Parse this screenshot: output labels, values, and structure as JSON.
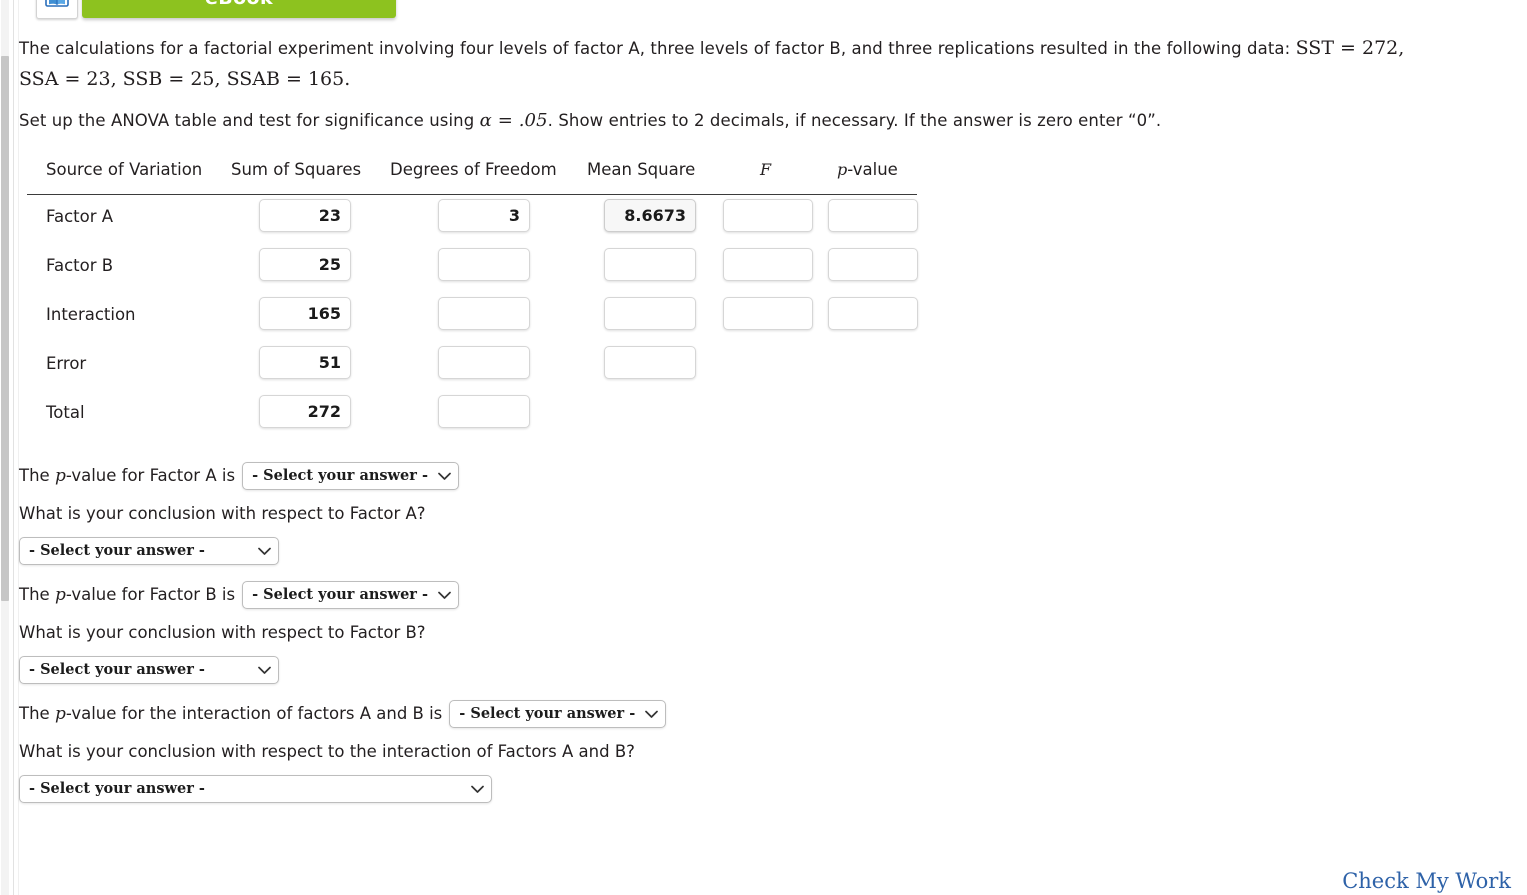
{
  "ebook": {
    "label": "eBook",
    "icon": "ebook-icon",
    "color": "#8dc21f"
  },
  "problem": {
    "statement_part1": "The calculations for a factorial experiment involving four levels of factor A, three levels of factor B, and three replications resulted in the following data: ",
    "statement_math1": "SST = 272,",
    "statement_math2": "SSA = 23, SSB = 25, SSAB = 165.",
    "instruction_part1": "Set up the ANOVA table and test for significance using ",
    "instruction_alpha": "α = .05",
    "instruction_part2": ". Show entries to 2 decimals, if necessary. If the answer is zero enter “0”."
  },
  "anova_table": {
    "headers": {
      "source": "Source of Variation",
      "ss": "Sum of Squares",
      "df": "Degrees of Freedom",
      "ms": "Mean Square",
      "f": "F",
      "p": "p",
      "p_suffix": "-value"
    },
    "rows": [
      {
        "label": "Factor A",
        "ss": "23",
        "df": "3",
        "ms": "8.6673",
        "f": "",
        "p": "",
        "ms_focused": true,
        "has_f": true,
        "has_p": true,
        "has_ms": true,
        "has_df": true
      },
      {
        "label": "Factor B",
        "ss": "25",
        "df": "",
        "ms": "",
        "f": "",
        "p": "",
        "ms_focused": false,
        "has_f": true,
        "has_p": true,
        "has_ms": true,
        "has_df": true
      },
      {
        "label": "Interaction",
        "ss": "165",
        "df": "",
        "ms": "",
        "f": "",
        "p": "",
        "ms_focused": false,
        "has_f": true,
        "has_p": true,
        "has_ms": true,
        "has_df": true
      },
      {
        "label": "Error",
        "ss": "51",
        "df": "",
        "ms": "",
        "f": "",
        "p": "",
        "ms_focused": false,
        "has_f": false,
        "has_p": false,
        "has_ms": true,
        "has_df": true
      },
      {
        "label": "Total",
        "ss": "272",
        "df": "",
        "ms": "",
        "f": "",
        "p": "",
        "ms_focused": false,
        "has_f": false,
        "has_p": false,
        "has_ms": false,
        "has_df": true
      }
    ]
  },
  "questions": {
    "select_placeholder": "- Select your answer -",
    "factor_a_pvalue_prefix": "The ",
    "factor_a_pvalue_p": "p",
    "factor_a_pvalue_suffix": "-value for Factor A is",
    "factor_a_conclusion": "What is your conclusion with respect to Factor A?",
    "factor_b_pvalue_prefix": "The ",
    "factor_b_pvalue_p": "p",
    "factor_b_pvalue_suffix": "-value for Factor B is",
    "factor_b_conclusion": "What is your conclusion with respect to Factor B?",
    "interaction_pvalue_prefix": "The ",
    "interaction_pvalue_p": "p",
    "interaction_pvalue_suffix": "-value for the interaction of factors A and B is",
    "interaction_conclusion": "What is your conclusion with respect to the interaction of Factors A and B?"
  },
  "footer": {
    "check_my_work": "Check My Work",
    "link_color": "#2e62a8"
  }
}
